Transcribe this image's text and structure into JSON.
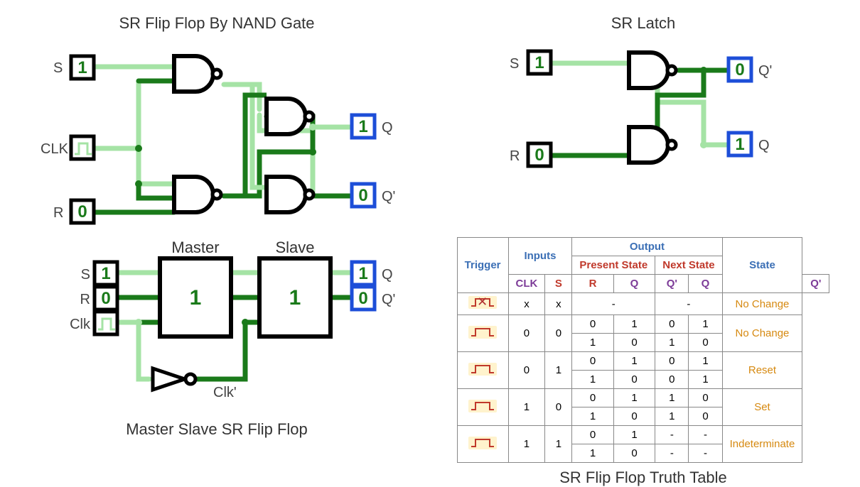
{
  "nand_ff": {
    "title": "SR Flip Flop By NAND Gate",
    "labels": {
      "s": "S",
      "r": "R",
      "clk": "CLK",
      "q": "Q",
      "qb": "Q'"
    },
    "values": {
      "s": "1",
      "r": "0",
      "q": "1",
      "qb": "0"
    }
  },
  "latch": {
    "title": "SR Latch",
    "labels": {
      "s": "S",
      "r": "R",
      "q": "Q",
      "qb": "Q'"
    },
    "values": {
      "s": "1",
      "r": "0",
      "qb": "0",
      "q": "1"
    }
  },
  "ms_ff": {
    "title": "Master Slave SR Flip Flop",
    "labels": {
      "s": "S",
      "r": "R",
      "clk": "Clk",
      "clkb": "Clk'",
      "master": "Master",
      "slave": "Slave",
      "q": "Q",
      "qb": "Q'"
    },
    "values": {
      "s": "1",
      "r": "0",
      "master": "1",
      "slave": "1",
      "q": "1",
      "qb": "0"
    }
  },
  "truth": {
    "title": "SR Flip Flop Truth Table",
    "headers": {
      "trigger": "Trigger",
      "inputs": "Inputs",
      "output": "Output",
      "present": "Present State",
      "next": "Next State",
      "state": "State",
      "clk": "CLK",
      "s": "S",
      "r": "R",
      "q": "Q",
      "qb": "Q'"
    },
    "rows": [
      {
        "clk": "x",
        "s": "x",
        "r": "x",
        "pq": "-",
        "pqb": "",
        "nq": "-",
        "nqb": "",
        "state": "No Change",
        "span": 1
      },
      {
        "clk": "hi",
        "s": "0",
        "r": "0",
        "pq": "0",
        "pqb": "1",
        "nq": "0",
        "nqb": "1",
        "state": "No Change",
        "span": 2
      },
      {
        "clk": "",
        "s": "",
        "r": "",
        "pq": "1",
        "pqb": "0",
        "nq": "1",
        "nqb": "0",
        "state": "",
        "span": 0
      },
      {
        "clk": "hi",
        "s": "0",
        "r": "1",
        "pq": "0",
        "pqb": "1",
        "nq": "0",
        "nqb": "1",
        "state": "Reset",
        "span": 2
      },
      {
        "clk": "",
        "s": "",
        "r": "",
        "pq": "1",
        "pqb": "0",
        "nq": "0",
        "nqb": "1",
        "state": "",
        "span": 0
      },
      {
        "clk": "hi",
        "s": "1",
        "r": "0",
        "pq": "0",
        "pqb": "1",
        "nq": "1",
        "nqb": "0",
        "state": "Set",
        "span": 2
      },
      {
        "clk": "",
        "s": "",
        "r": "",
        "pq": "1",
        "pqb": "0",
        "nq": "1",
        "nqb": "0",
        "state": "",
        "span": 0
      },
      {
        "clk": "hi",
        "s": "1",
        "r": "1",
        "pq": "0",
        "pqb": "1",
        "nq": "-",
        "nqb": "-",
        "state": "Indeterminate",
        "span": 2
      },
      {
        "clk": "",
        "s": "",
        "r": "",
        "pq": "1",
        "pqb": "0",
        "nq": "-",
        "nqb": "-",
        "state": "",
        "span": 0
      }
    ]
  },
  "colors": {
    "gate": "#000",
    "wire_hi": "#a5e3a5",
    "wire_lo": "#1a7a1a",
    "io_black": "#000",
    "io_blue": "#1d4ed8",
    "val_green": "#1a7a1a"
  }
}
